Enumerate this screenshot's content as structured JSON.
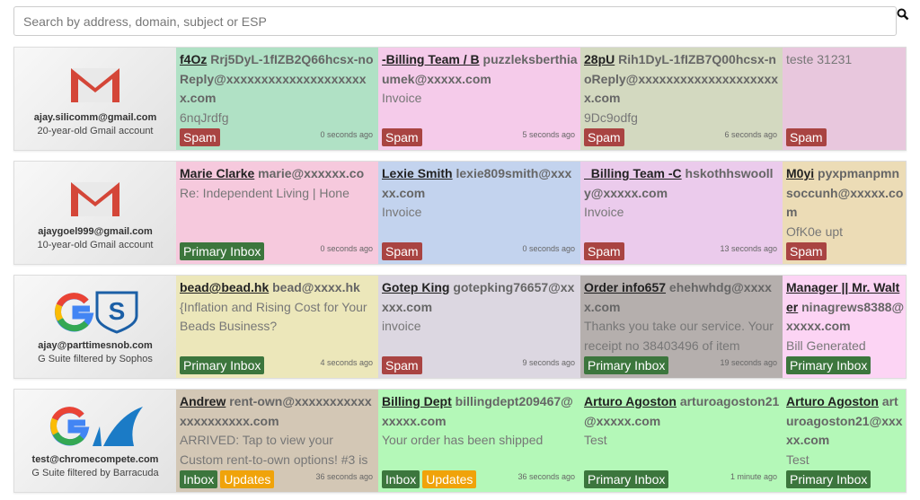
{
  "search": {
    "placeholder": "Search by address, domain, subject or ESP",
    "icon": "search-icon"
  },
  "colors": {
    "spam": "#a94442",
    "primary": "#3c763d",
    "updates": "#f0a30a"
  },
  "rows": [
    {
      "account": {
        "email": "ajay.silicomm@gmail.com",
        "desc": "20-year-old Gmail account",
        "logo": "gmail"
      },
      "cells": [
        {
          "name": "f4Oz",
          "email": "Rrj5DyL-1fIZB2Q66hcsx-noReply@xxxxxxxxxxxxxxxxxxxxx.com",
          "subject": "6nqJrdfg",
          "badges": [
            "Spam"
          ],
          "time": "0 seconds ago",
          "bg": "#b0e1c5"
        },
        {
          "name": "-Billing Team / B",
          "email": "puzzleksberthiaumek@xxxxx.com",
          "subject": "Invoice",
          "badges": [
            "Spam"
          ],
          "time": "5 seconds ago",
          "bg": "#f5cbea"
        },
        {
          "name": "28pU",
          "email": "Rih1DyL-1fIZB7Q00hcsx-noReply@xxxxxxxxxxxxxxxxxxxxx.com",
          "subject": "9Dc9odfg",
          "badges": [
            "Spam"
          ],
          "time": "6 seconds ago",
          "bg": "#d3d9c0"
        },
        {
          "name": "",
          "email": "",
          "subject": "teste 31231",
          "badges": [
            "Spam"
          ],
          "time": "",
          "bg": "#e8c7dd"
        }
      ]
    },
    {
      "account": {
        "email": "ajaygoel999@gmail.com",
        "desc": "10-year-old Gmail account",
        "logo": "gmail"
      },
      "cells": [
        {
          "name": "Marie Clarke",
          "email": "marie@xxxxxx.co",
          "subject": "Re: Independent Living | Hone",
          "badges": [
            "Primary Inbox"
          ],
          "time": "0 seconds ago",
          "bg": "#f6c9dd"
        },
        {
          "name": "Lexie Smith",
          "email": "lexie809smith@xxxxx.com",
          "subject": "Invoice",
          "badges": [
            "Spam"
          ],
          "time": "0 seconds ago",
          "bg": "#c3d3ee"
        },
        {
          "name": "_Billing Team -C",
          "email": "hskothhswoolly@xxxxx.com",
          "subject": "Invoice",
          "badges": [
            "Spam"
          ],
          "time": "13 seconds ago",
          "bg": "#ebcbec"
        },
        {
          "name": "M0yi",
          "email": "pyxpmanpmnsoccunh@xxxxx.com",
          "subject": "OfK0e upt",
          "badges": [
            "Spam"
          ],
          "time": "",
          "bg": "#ecdcb6"
        }
      ]
    },
    {
      "account": {
        "email": "ajay@parttimesnob.com",
        "desc": "G Suite filtered by Sophos",
        "logo": "gsuite-sophos"
      },
      "cells": [
        {
          "name": "bead@bead.hk",
          "email": "bead@xxxx.hk",
          "subject": "{Inflation and Rising Cost for Your Beads Business?",
          "badges": [
            "Primary Inbox"
          ],
          "time": "4 seconds ago",
          "bg": "#ece7ba"
        },
        {
          "name": "Gotep King",
          "email": "gotepking76657@xxxxx.com",
          "subject": "invoice",
          "badges": [
            "Spam"
          ],
          "time": "9 seconds ago",
          "bg": "#dcd7e1"
        },
        {
          "name": "Order info657",
          "email": "ehehwhdg@xxxxx.com",
          "subject": "Thanks you take our service. Your receipt no 38403496 of item",
          "badges": [
            "Primary Inbox"
          ],
          "time": "19 seconds ago",
          "bg": "#b5afad"
        },
        {
          "name": "Manager || Mr. Walter",
          "email": "ninagrews8388@xxxxx.com",
          "subject": "Bill Generated",
          "badges": [
            "Primary Inbox"
          ],
          "time": "",
          "bg": "#fcd4f4"
        }
      ]
    },
    {
      "account": {
        "email": "test@chromecompete.com",
        "desc": "G Suite filtered by Barracuda",
        "logo": "gsuite-barracuda"
      },
      "cells": [
        {
          "name": "Andrew",
          "email": "rent-own@xxxxxxxxxxxxxxxxxxxxx.com",
          "subject": "ARRIVED: Tap to view your Custom rent-to-own options! #3 is",
          "badges": [
            "Inbox",
            "Updates"
          ],
          "time": "36 seconds ago",
          "bg": "#d3c7b5"
        },
        {
          "name": "Billing Dept",
          "email": "billingdept209467@xxxxx.com",
          "subject": "Your order has been shipped",
          "badges": [
            "Inbox",
            "Updates"
          ],
          "time": "36 seconds ago",
          "bg": "#b4f8b8"
        },
        {
          "name": "Arturo Agoston",
          "email": "arturoagoston21@xxxxx.com",
          "subject": "Test",
          "badges": [
            "Primary Inbox"
          ],
          "time": "1 minute ago",
          "bg": "#b4f8b8"
        },
        {
          "name": "Arturo Agoston",
          "email": "arturoagoston21@xxxxx.com",
          "subject": "Test",
          "badges": [
            "Primary Inbox"
          ],
          "time": "",
          "bg": "#b4f8b8"
        }
      ]
    }
  ]
}
